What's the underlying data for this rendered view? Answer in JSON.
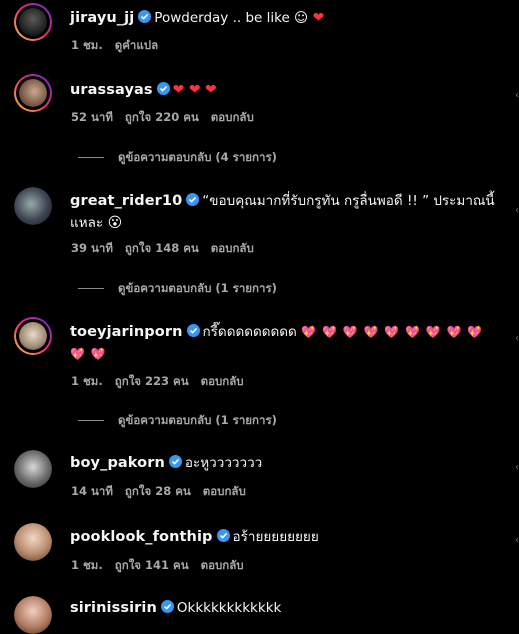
{
  "comments": [
    {
      "username": "jirayu_jj",
      "text": "Powderday .. be like ☺",
      "emoji": "❤",
      "time": "1 ชม.",
      "translate": "ดูคำแปล"
    },
    {
      "username": "urassayas",
      "text": "",
      "emoji": "❤ ❤ ❤",
      "time": "52 นาที",
      "likes": "ถูกใจ 220 คน",
      "reply": "ตอบกลับ",
      "view_replies": "ดูข้อความตอบกลับ (4 รายการ)"
    },
    {
      "username": "great_rider10",
      "text": "“ขอบคุณมากที่รับกรูทัน กรูลื่นพอดี !! ” ประมาณนี้แหละ",
      "emoji": "😮",
      "time": "39 นาที",
      "likes": "ถูกใจ 148 คน",
      "reply": "ตอบกลับ",
      "view_replies": "ดูข้อความตอบกลับ (1 รายการ)"
    },
    {
      "username": "toeyjarinporn",
      "text": "กรี๊ดดดดดดดดด",
      "emoji": "💖 💖 💖 💖 💖 💖 💖 💖 💖 💖 💖",
      "time": "1 ชม.",
      "likes": "ถูกใจ 223 คน",
      "reply": "ตอบกลับ",
      "view_replies": "ดูข้อความตอบกลับ (1 รายการ)"
    },
    {
      "username": "boy_pakorn",
      "text": "อะหูววววววว",
      "time": "14 นาที",
      "likes": "ถูกใจ 28 คน",
      "reply": "ตอบกลับ"
    },
    {
      "username": "pooklook_fonthip",
      "text": "อร้ายยยยยยยย",
      "time": "1 ชม.",
      "likes": "ถูกใจ 141 คน",
      "reply": "ตอบกลับ"
    },
    {
      "username": "sirinissirin",
      "text": "Okkkkkkkkkkkk"
    }
  ],
  "colors": {
    "background": "#000000",
    "verified": "#3897f0",
    "meta": "#a8a8a8",
    "heart": "#ff3040"
  }
}
